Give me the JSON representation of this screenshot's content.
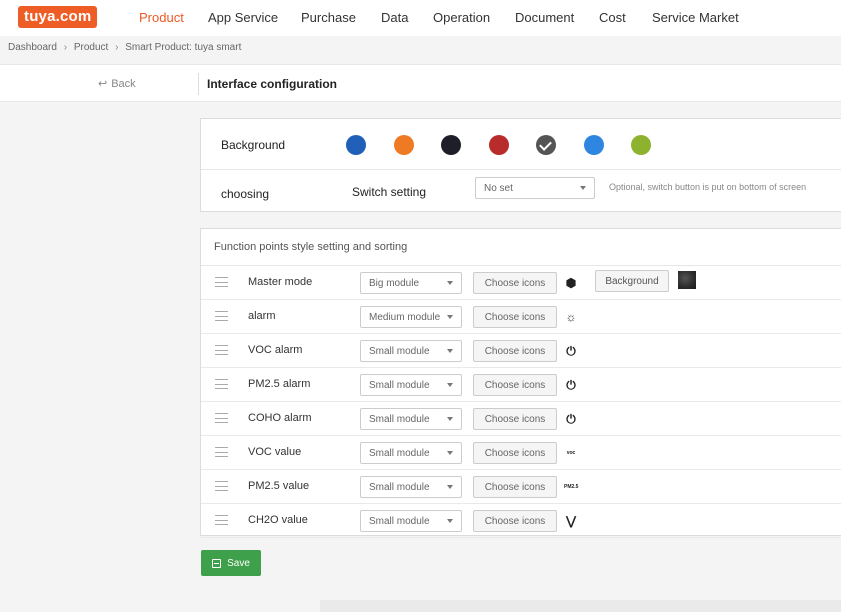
{
  "brand": {
    "logo_text": "tuya.com",
    "accent": "#ef5d27"
  },
  "nav": {
    "items": [
      {
        "label": "Product",
        "active": true
      },
      {
        "label": "App Service"
      },
      {
        "label": "Purchase"
      },
      {
        "label": "Data"
      },
      {
        "label": "Operation"
      },
      {
        "label": "Document"
      },
      {
        "label": "Cost"
      },
      {
        "label": "Service Market"
      }
    ]
  },
  "breadcrumb": {
    "items": [
      "Dashboard",
      "Product",
      "Smart Product: tuya smart"
    ]
  },
  "header": {
    "back_label": "Back",
    "title": "Interface configuration"
  },
  "background": {
    "label": "Background",
    "swatches": [
      {
        "color": "#2160b8"
      },
      {
        "color": "#ef7a24"
      },
      {
        "color": "#1e1e28"
      },
      {
        "color": "#b82c2c"
      },
      {
        "color": "#555555",
        "selected": true
      },
      {
        "color": "#2f86e0"
      },
      {
        "color": "#8db22e"
      }
    ]
  },
  "switch": {
    "choosing_label": "choosing",
    "label": "Switch setting",
    "value": "No set",
    "hint": "Optional, switch button is put on bottom of screen"
  },
  "functions": {
    "title": "Function points style setting and sorting",
    "choose_label": "Choose icons",
    "background_label": "Background",
    "rows": [
      {
        "name": "Master mode",
        "module": "Big module",
        "icon": "hexagon-icon",
        "glyph": "⬢"
      },
      {
        "name": "alarm",
        "module": "Medium module",
        "icon": "alarm-icon",
        "glyph": "☼"
      },
      {
        "name": "VOC alarm",
        "module": "Small module",
        "icon": "power-icon",
        "glyph": "⏻"
      },
      {
        "name": "PM2.5 alarm",
        "module": "Small module",
        "icon": "power-icon",
        "glyph": "⏻"
      },
      {
        "name": "COHO alarm",
        "module": "Small module",
        "icon": "power-icon",
        "glyph": "⏻"
      },
      {
        "name": "VOC value",
        "module": "Small module",
        "icon": "voc-icon",
        "glyph": "voc"
      },
      {
        "name": "PM2.5 value",
        "module": "Small module",
        "icon": "pm-icon",
        "glyph": "PM2.5"
      },
      {
        "name": "CH2O value",
        "module": "Small module",
        "icon": "molecule-icon",
        "glyph": "⋁"
      }
    ]
  },
  "save": {
    "label": "Save",
    "color": "#3ea04a"
  }
}
